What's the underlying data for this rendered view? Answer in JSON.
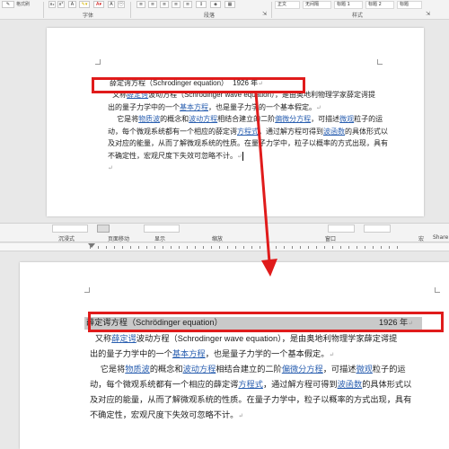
{
  "ribbon": {
    "format_painter_label": "格式刷",
    "group_font": "字体",
    "group_paragraph": "段落",
    "group_styles": "样式",
    "style_items": [
      "正文",
      "无间隔",
      "标题 1",
      "标题 2",
      "标题"
    ]
  },
  "ribbon2": {
    "items": [
      "沉浸式",
      "页面移动",
      "显示",
      "缩放",
      "窗口",
      "宏",
      "Share"
    ]
  },
  "doc": {
    "title_cn": "薛定谔方程",
    "title_en": "（Schrodinger equation）",
    "title_year": "1926 年",
    "title2_en": "（Schrödinger equation）",
    "para_mark": "↵",
    "p1_a": "又称",
    "p1_link1": "薛定谔",
    "p1_b": "波动方程（",
    "p1_en": "Schrodinger wave equation",
    "p1_c": "），是由奥地利物理学家薛定谔提",
    "p1_line2_a": "出的量子力学中的一个",
    "p1_link2": "基本方程",
    "p1_line2_b": "，也是量子力学的一个基本假定。",
    "p2_a": "它是将",
    "p2_link1": "物质波",
    "p2_b": "的概念和",
    "p2_link2": "波动方程",
    "p2_c": "相结合建立的二阶",
    "p2_link3": "偏微分方程",
    "p2_d": "，可描述",
    "p2_link4": "微观",
    "p2_e": "粒子的运",
    "p2_line2_a": "动，每个微观系统都有一个相应的薛定谔",
    "p2_link5": "方程式",
    "p2_line2_b": "，通过解方程可得到",
    "p2_link6": "波函数",
    "p2_line2_c": "的具体形式以",
    "p2_line3": "及对应的能量，从而了解微观系统的性质。在量子力学中，粒子以概率的方式出现，具有",
    "p2_line4": "不确定性，宏观尺度下失效可忽略不计。"
  },
  "colors": {
    "annotation_red": "#e01b1b",
    "link_blue": "#2a5fb0",
    "highlight_gray": "#c9c9c9"
  }
}
